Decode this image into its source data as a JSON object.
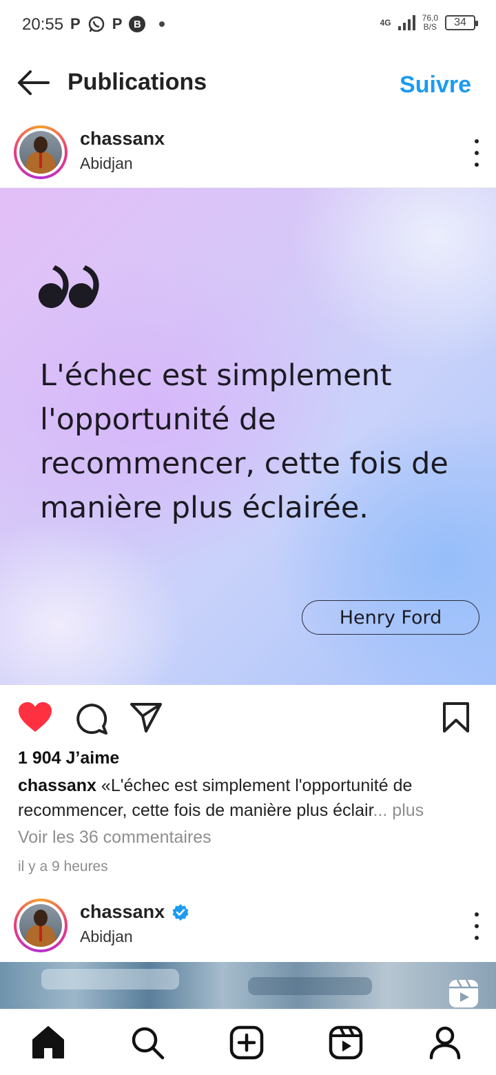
{
  "status_bar": {
    "time": "20:55",
    "left_icons": [
      "P",
      "whatsapp-icon",
      "P",
      "B"
    ],
    "network": "4G",
    "speed_top": "76,0",
    "speed_bottom": "B/S",
    "battery": "34"
  },
  "header": {
    "title": "Publications",
    "follow_label": "Suivre"
  },
  "post1": {
    "username": "chassanx",
    "location": "Abidjan",
    "image": {
      "quote": "L'échec est simplement l'opportunité de recommencer, cette fois de manière plus éclairée.",
      "author": "Henry Ford"
    },
    "likes": "1 904 J’aime",
    "caption_user": "chassanx",
    "caption_text": "«L'échec est simplement l'opportunité de recommencer, cette fois de manière plus éclair",
    "caption_more": "... plus",
    "comments_link": "Voir les 36 commentaires",
    "time_ago": "il y a 9 heures",
    "liked": true,
    "like_color": "#ff3040"
  },
  "post2": {
    "username": "chassanx",
    "location": "Abidjan",
    "verified": true
  },
  "bottom_nav": {
    "items": [
      "home-icon",
      "search-icon",
      "create-icon",
      "reels-icon",
      "profile-icon"
    ]
  },
  "colors": {
    "accent": "#1a9bf0",
    "secondary_text": "#8e8e8e",
    "verified": "#1d9bf0"
  }
}
